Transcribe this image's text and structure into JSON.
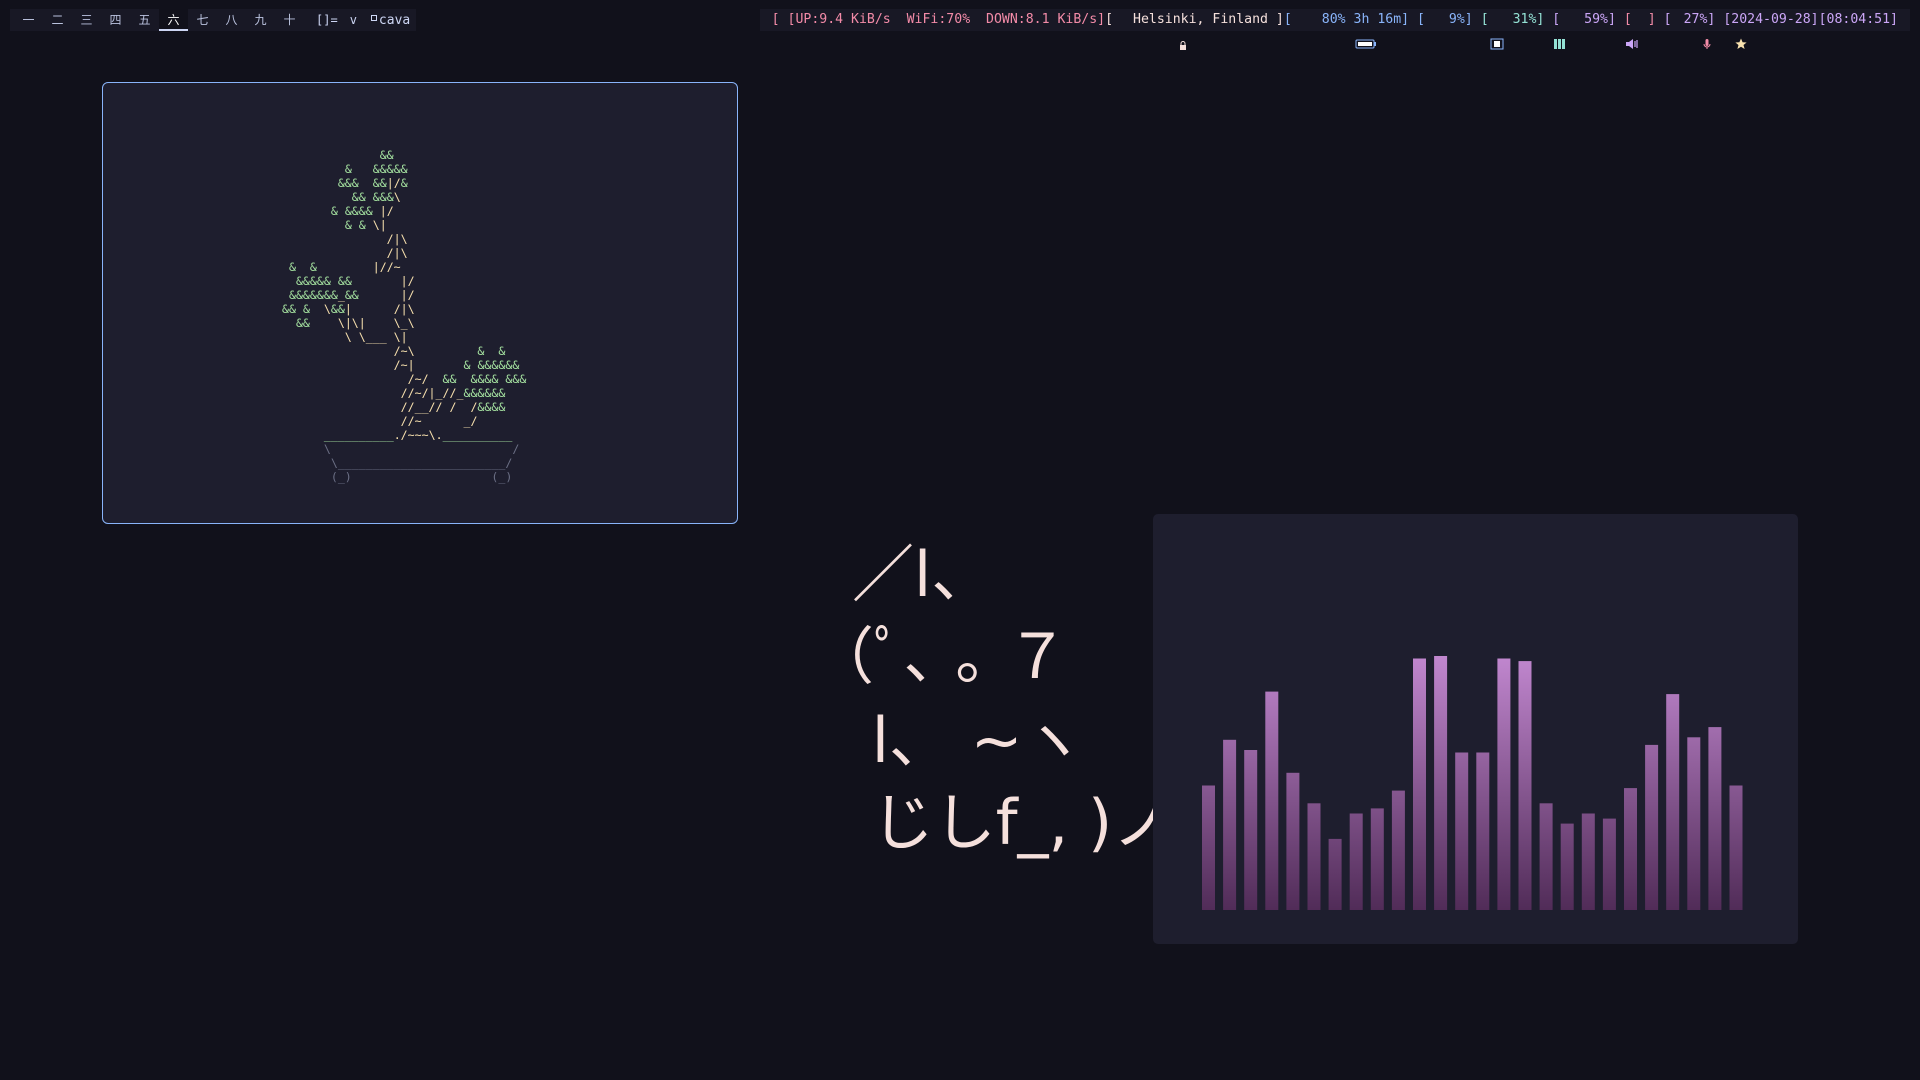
{
  "bar": {
    "tags": [
      "一",
      "二",
      "三",
      "四",
      "五",
      "六",
      "七",
      "八",
      "九",
      "十"
    ],
    "active_tag_index": 5,
    "layout_symbol": "[]=",
    "layout_extra": "v",
    "window_title": "cava",
    "status": {
      "net": "[ [UP:9.4 KiB/s  WiFi:70%  DOWN:8.1 KiB/s]",
      "weather_open": "[",
      "weather": " Helsinki, Finland ]",
      "battery_open": "[",
      "battery": " 80% 3h 16m]",
      "brightness_open": " [",
      "brightness": " 9%]",
      "memory_open": " [",
      "memory": " 31%]",
      "volume_open": " [",
      "volume": " 59%]",
      "mic": " [ ",
      "mic_close": "]",
      "updates_open": " [",
      "updates": "27%]",
      "datetime": " [2024-09-28][08:04:51]",
      "icons": [
        "lock-icon",
        "battery-icon",
        "brightness-icon",
        "memory-icon",
        "volume-icon",
        "microphone-icon",
        "star-icon"
      ]
    }
  },
  "bonsai": {
    "lines": [
      "               &&",
      "          &   &&&&&",
      "         &&&  &&|/&",
      "           && &&&\\",
      "        & &&&& |/",
      "          & & \\|",
      "                /|\\",
      "                /|\\",
      "  &  &        |//~",
      "   &&&&& &&       |/",
      "  &&&&&&&_&&      |/",
      " && &  \\&&|      /|\\",
      "   &&    \\|\\|    \\_\\",
      "          \\ \\___ \\|",
      "                 /~\\         &  &",
      "                 /~|       & &&&&&&",
      "                   /~/  &&  &&&& &&&",
      "                  //~/|_//_&&&&&&",
      "                  //__// /  /&&&&",
      "                  //~      _/",
      "       __________./~~~\\.__________",
      "       \\                          /",
      "        \\________________________/",
      "        (_)                    (_)"
    ],
    "colors": {
      "leaf": "#a6e3a1",
      "trunk": "#f9e2af",
      "pot": "#6c7086"
    }
  },
  "cat": {
    "lines": [
      "／l、",
      "（ﾟ､ ｡ ７",
      " l、 ~ヽ",
      " じしf_, )ノ"
    ]
  },
  "cava": {
    "bar_values": [
      0.49,
      0.67,
      0.63,
      0.86,
      0.54,
      0.42,
      0.28,
      0.38,
      0.4,
      0.47,
      0.99,
      1.0,
      0.62,
      0.62,
      0.99,
      0.98,
      0.42,
      0.34,
      0.38,
      0.36,
      0.48,
      0.65,
      0.85,
      0.68,
      0.72,
      0.49
    ],
    "top_color": "#c187cf",
    "bottom_color": "#512c58"
  }
}
